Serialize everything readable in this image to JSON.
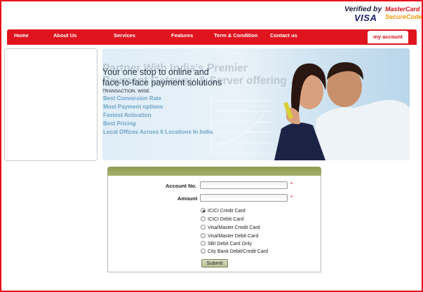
{
  "logos": {
    "verified_by": "Verified by",
    "visa": "VISA",
    "mastercard": "MasterCard",
    "securecode": "SecureCode"
  },
  "nav": {
    "items": [
      "Home",
      "About Us",
      "Services",
      "Features",
      "Term & Condition",
      "Contact us"
    ],
    "my_account": "my account"
  },
  "banner": {
    "faded_title_1": "Partner With India's Premier",
    "faded_title_2": "Payment Gateway & Server offering",
    "tagline_1": "Your one stop to online and",
    "tagline_2": "face-to-face payment solutions",
    "small_text": "TRANSACTION. WISE.",
    "features": [
      "Best Conversion Rate",
      "Most Payment options",
      "Fastest Activation",
      "Best Pricing",
      "Local Offices Across 6 Locations In India"
    ]
  },
  "form": {
    "account_label": "Account No.",
    "account_value": "",
    "amount_label": "Amount",
    "amount_value": "",
    "required_mark": "*",
    "payment_options": [
      "ICICI Credit Card",
      "ICICI Debit Card",
      "Visa/Master Credit Card",
      "Visa/Master Debit Card",
      "SBI Debit Card Only",
      "City Bank Debit/Credit Card"
    ],
    "selected_option": "ICICI Credit Card",
    "submit_label": "Submit"
  },
  "colors": {
    "brand_red": "#e0141e",
    "form_header": "#9aa461",
    "feature_text": "#6fa4c8"
  }
}
